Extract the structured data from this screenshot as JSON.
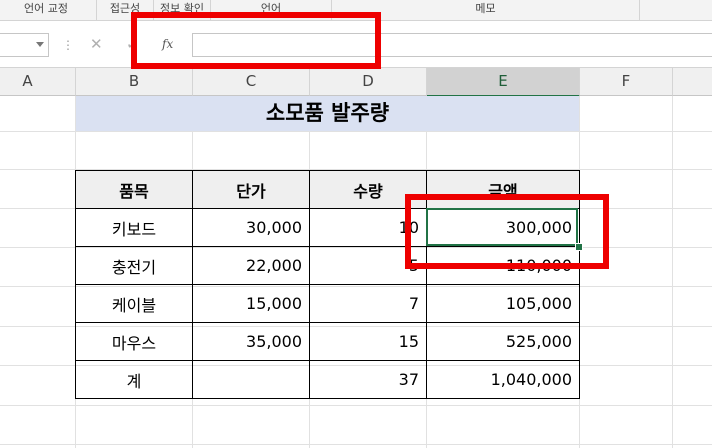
{
  "ribbon": {
    "groups": [
      "언어 교정",
      "접근성",
      "정보 확인",
      "언어",
      "메모"
    ]
  },
  "formula_bar": {
    "namebox_value": "",
    "cancel_glyph": "✕",
    "enter_glyph": "✓",
    "fx_label": "fx",
    "formula_value": ""
  },
  "columns": [
    "A",
    "B",
    "C",
    "D",
    "E",
    "F"
  ],
  "selected_column": "E",
  "sheet": {
    "title": "소모품 발주량",
    "headers": [
      "품목",
      "단가",
      "수량",
      "금액"
    ],
    "rows": [
      [
        "키보드",
        "30,000",
        "10",
        "300,000"
      ],
      [
        "충전기",
        "22,000",
        "5",
        "110,000"
      ],
      [
        "케이블",
        "15,000",
        "7",
        "105,000"
      ],
      [
        "마우스",
        "35,000",
        "15",
        "525,000"
      ]
    ],
    "total": [
      "계",
      "",
      "37",
      "1,040,000"
    ]
  },
  "colors": {
    "title_band": "#dae1f2",
    "selection": "#217346",
    "annotation": "#ee0000"
  }
}
